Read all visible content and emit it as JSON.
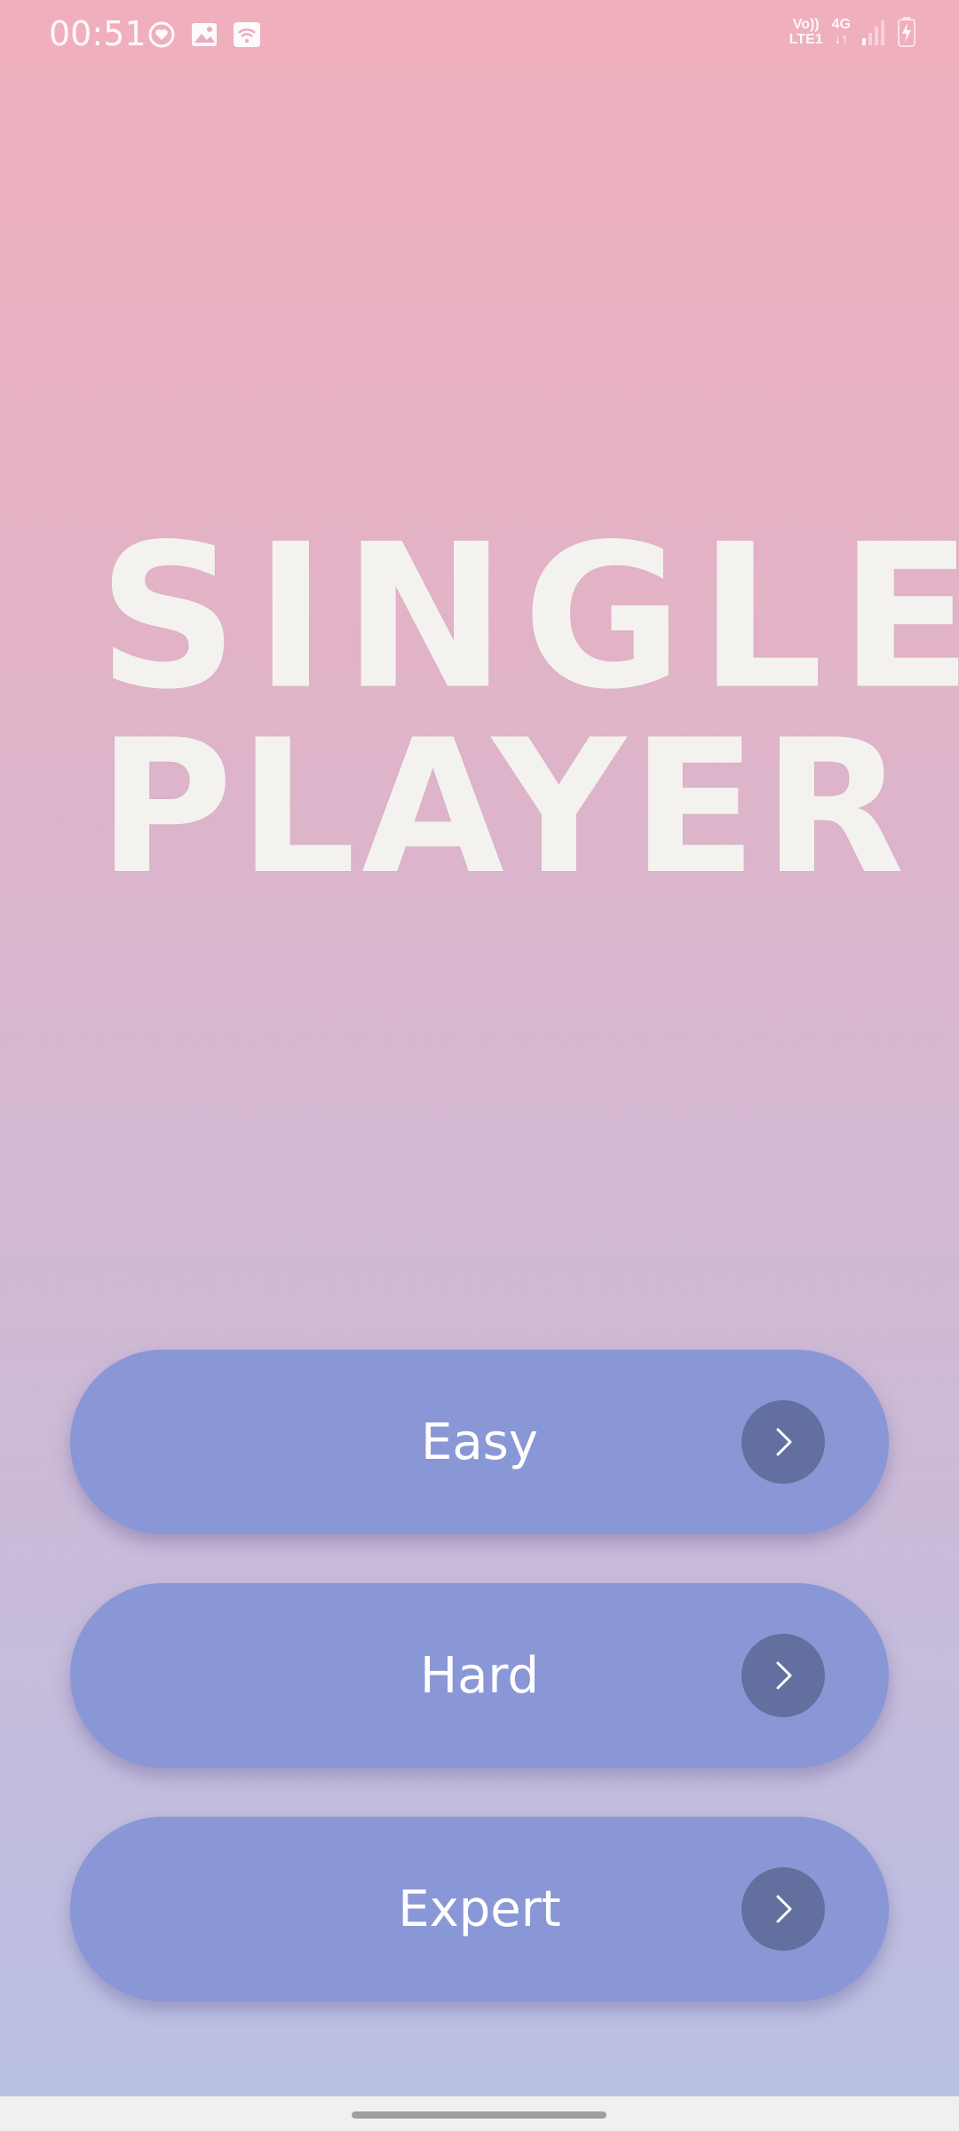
{
  "status_bar": {
    "time": "00:51",
    "left_icons": [
      "sync-heart-icon",
      "image-icon",
      "wifi-calling-icon"
    ],
    "volte_top": "Vo))",
    "volte_bottom": "LTE1",
    "network_top": "4G",
    "network_bottom": "↓↑",
    "right_icons": [
      "signal-icon",
      "battery-charging-icon"
    ]
  },
  "title": {
    "line1": "SINGLE",
    "line2": "PLAYER"
  },
  "buttons": [
    {
      "label": "Easy",
      "icon": "chevron-right-icon"
    },
    {
      "label": "Hard",
      "icon": "chevron-right-icon"
    },
    {
      "label": "Expert",
      "icon": "chevron-right-icon"
    }
  ],
  "colors": {
    "background_top": "#f0afbc",
    "background_bottom": "#b8c0e4",
    "button_bg": "#8a97d6",
    "arrow_circle_bg": "#636f9e",
    "title_color": "#f4f2ef"
  }
}
